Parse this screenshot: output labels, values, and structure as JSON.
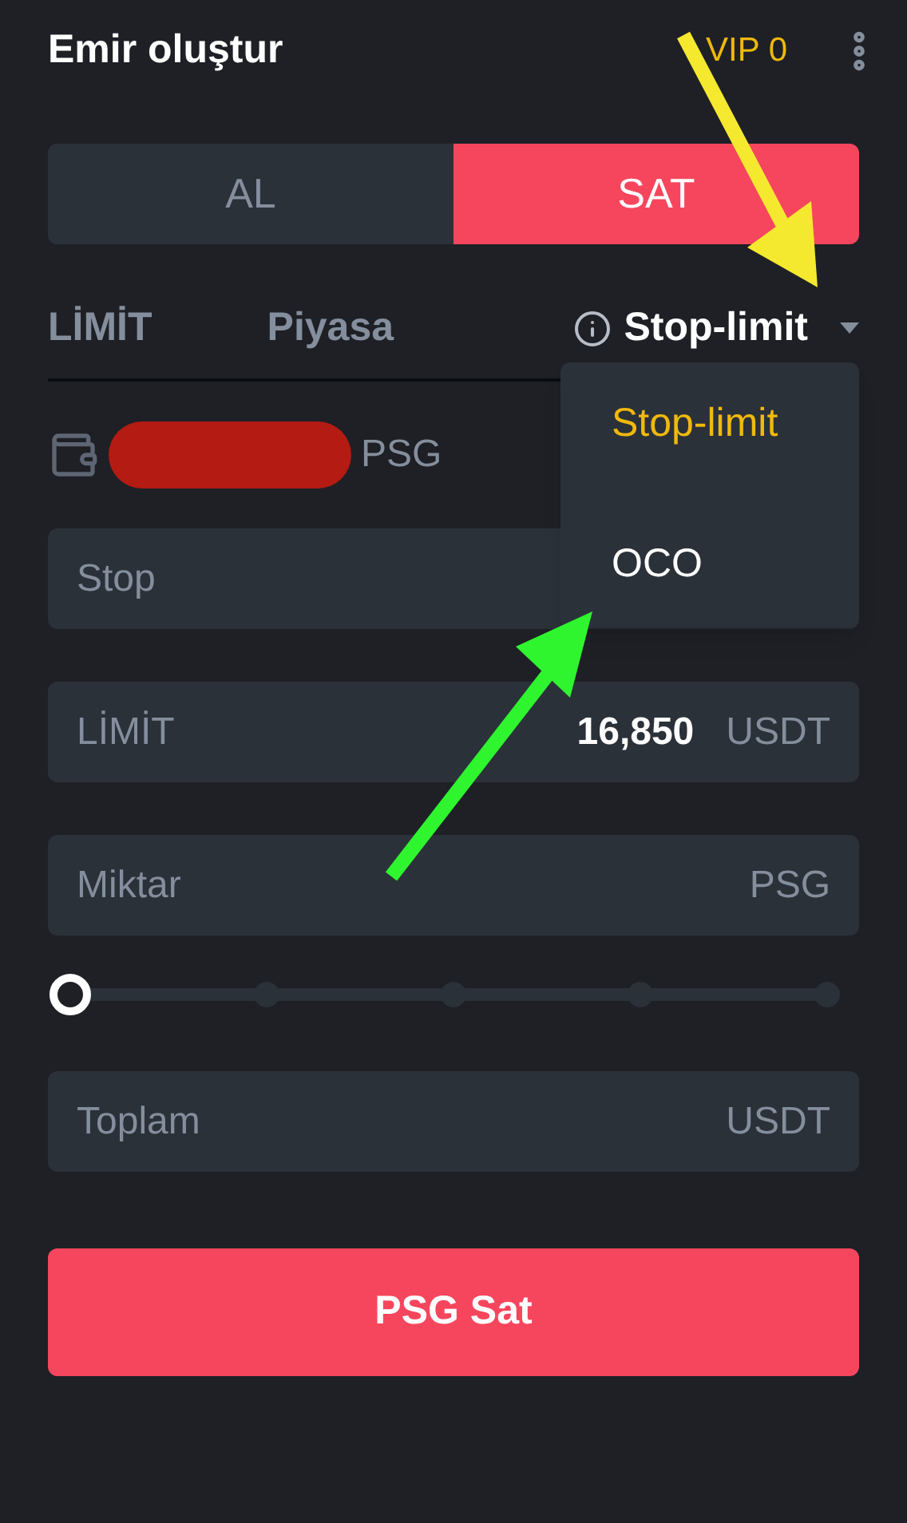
{
  "header": {
    "title": "Emir oluştur",
    "vip": "VIP 0"
  },
  "sides": [
    {
      "label": "AL",
      "selected": false
    },
    {
      "label": "SAT",
      "selected": true
    }
  ],
  "order_types": [
    {
      "label": "LİMİT",
      "selected": false,
      "kind": "tab"
    },
    {
      "label": "Piyasa",
      "selected": false,
      "kind": "tab"
    },
    {
      "label": "Stop-limit",
      "selected": true,
      "kind": "dropdown"
    }
  ],
  "dropdown": {
    "expanded": true,
    "options": [
      {
        "label": "Stop-limit",
        "selected": true
      },
      {
        "label": "OCO",
        "selected": false
      }
    ]
  },
  "balance": {
    "unit": "PSG",
    "redacted": true
  },
  "fields": [
    {
      "placeholder": "Stop"
    },
    {
      "label": "LİMİT",
      "value": "16,850",
      "unit": "USDT"
    },
    {
      "placeholder": "Miktar",
      "unit": "PSG"
    }
  ],
  "slider": {
    "level": 0
  },
  "total": {
    "placeholder": "Toplam",
    "unit": "USDT"
  },
  "submit": "PSG Sat"
}
